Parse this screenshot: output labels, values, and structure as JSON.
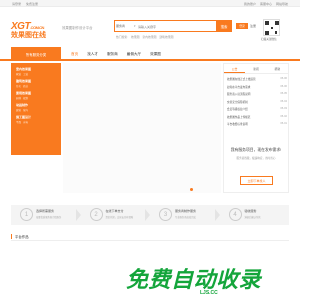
{
  "topbar": {
    "left": [
      "请登录",
      "免费注册"
    ],
    "right": [
      "我的账户",
      "客服中心",
      "网站导航"
    ]
  },
  "header": {
    "logo_brand": "XGT",
    "logo_domain": ".COM.CN",
    "logo_name": "效果图在线",
    "slogan": "效果图制作设计平台",
    "search_category": "服务商",
    "search_placeholder": "请输入关键字",
    "search_button": "搜索",
    "hot_label": "热门搜索:",
    "hot_keywords": [
      "效果图",
      "室内效果图",
      "建筑效果图"
    ],
    "login": "登录",
    "register": "注册",
    "qr_label": "扫描关注微信"
  },
  "nav": {
    "all_categories": "所有服务分类",
    "items": [
      "首页",
      "找人才",
      "服务商",
      "雇佣大厅",
      "效果图"
    ],
    "active_index": 0
  },
  "sidebar": {
    "categories": [
      {
        "title": "室内效果图",
        "links": [
          "家装",
          "工装"
        ]
      },
      {
        "title": "建筑效果图",
        "links": [
          "住宅",
          "商业"
        ]
      },
      {
        "title": "景观效果图",
        "links": [
          "园林",
          "规划"
        ]
      },
      {
        "title": "动画制作",
        "links": [
          "建筑",
          "室内"
        ]
      },
      {
        "title": "施工图设计",
        "links": [
          "平面",
          "水电"
        ]
      }
    ]
  },
  "right_panel": {
    "tabs": [
      "公告",
      "新闻",
      "帮助"
    ],
    "active_tab": 0,
    "news": [
      {
        "title": "效果图在线正式上线运营",
        "date": "05-06"
      },
      {
        "title": "如何在平台发布需求",
        "date": "05-06"
      },
      {
        "title": "服务商入驻流程说明",
        "date": "05-05"
      },
      {
        "title": "交易安全保障机制",
        "date": "05-04"
      },
      {
        "title": "会员等级权益介绍",
        "date": "05-03"
      },
      {
        "title": "效果图作品上传规范",
        "date": "05-02"
      },
      {
        "title": "平台收费标准说明",
        "date": "05-01"
      }
    ],
    "promo_title": "我有服务项目，现在发布需求!",
    "promo_sub": "服务商找我，极速响应，省时省心",
    "promo_button": "立即下单找人"
  },
  "steps": [
    {
      "num": "1",
      "title": "选择所需服务",
      "desc": "海量优质服务商为您服务"
    },
    {
      "num": "2",
      "title": "在线下单支付",
      "desc": "资金托管，交易安全有保障"
    },
    {
      "num": "3",
      "title": "服务商制作服务",
      "desc": "专业服务商高效完成"
    },
    {
      "num": "4",
      "title": "验收服务",
      "desc": "满意后确认付款"
    }
  ],
  "sections": {
    "works_title": "平台作品"
  },
  "watermark": {
    "text": "免费自动收录",
    "url": "LJS.CC"
  },
  "colors": {
    "accent": "#f97a1f",
    "watermark": "#14a53b"
  }
}
